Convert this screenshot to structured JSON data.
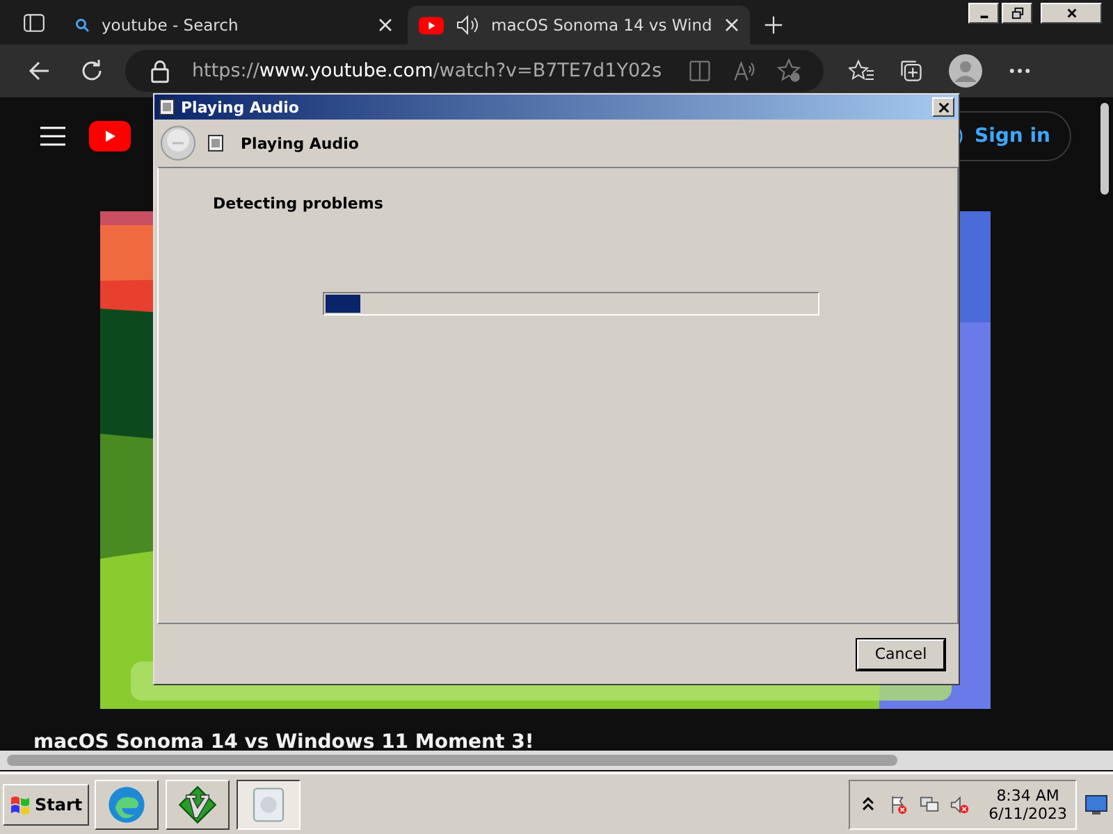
{
  "browser": {
    "tabs": [
      {
        "title": "youtube - Search",
        "selected": false,
        "audio": false
      },
      {
        "title": "macOS Sonoma 14 vs Wind",
        "selected": true,
        "audio": true
      }
    ],
    "address": {
      "scheme": "https://",
      "host": "www.youtube.com",
      "path": "/watch?v=B7TE7d1Y02s"
    }
  },
  "page": {
    "sign_in": "Sign in",
    "video_title": "macOS Sonoma 14 vs Windows 11 Moment 3!"
  },
  "dialog": {
    "title": "Playing Audio",
    "header": "Playing Audio",
    "status": "Detecting problems",
    "progress": {
      "level": 0.07
    },
    "buttons": [
      "Cancel"
    ]
  },
  "taskbar": {
    "start": "Start",
    "tasks": [
      {
        "kind": "edge",
        "selected": false
      },
      {
        "kind": "vim",
        "selected": false
      },
      {
        "kind": "troubleshooter",
        "selected": true
      }
    ],
    "clock": {
      "time": "8:34 AM",
      "date": "6/11/2023"
    }
  }
}
